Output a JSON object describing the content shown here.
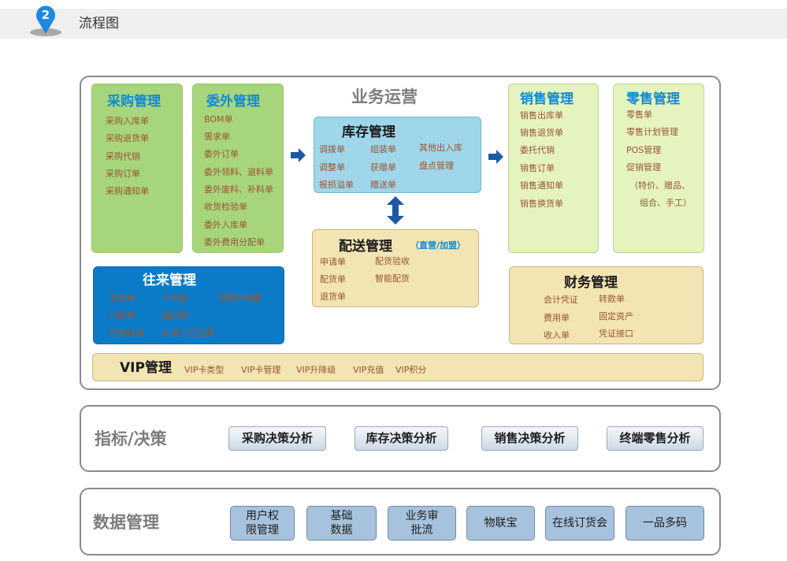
{
  "header": {
    "step_number": "2",
    "title": "流程图"
  },
  "business": {
    "title": "业务运营",
    "purchase": {
      "title": "采购管理",
      "items": [
        "采购入库单",
        "采购退货单",
        "采购代销",
        "采购订单",
        "采购通知单"
      ]
    },
    "outsource": {
      "title": "委外管理",
      "items": [
        "BOM单",
        "需求单",
        "委外订单",
        "委外领料、退料单",
        "委外废料、补料单",
        "收货检验单",
        "委外入库单",
        "委外费用分配单"
      ]
    },
    "inventory": {
      "title": "库存管理",
      "col1": [
        "调拨单",
        "调整单",
        "报损溢单"
      ],
      "col2": [
        "组装单",
        "获赠单",
        "赠送单"
      ],
      "col3": [
        "其他出入库",
        "盘点管理"
      ]
    },
    "delivery": {
      "title": "配送管理",
      "subtitle": "（直营/加盟）",
      "col1": [
        "申请单",
        "配货单",
        "退货单"
      ],
      "col2": [
        "配货验收",
        "智能配货"
      ]
    },
    "sales": {
      "title": "销售管理",
      "items": [
        "销售出库单",
        "销售退货单",
        "委托代销",
        "销售订单",
        "销售通知单",
        "销售换货单"
      ]
    },
    "retail": {
      "title": "零售管理",
      "items": [
        "零售单",
        "零售计划管理",
        "POS管理",
        "促销管理",
        "（特价、赠品、",
        "组合、手工）"
      ]
    },
    "payments": {
      "title": "往来管理",
      "col1": [
        "收款单",
        "付款单",
        "往来核销"
      ],
      "col2": [
        "应收款",
        "应付款",
        "商城专柜结算"
      ],
      "col3": [
        "退换货调整"
      ]
    },
    "finance": {
      "title": "财务管理",
      "col1": [
        "会计凭证",
        "费用单",
        "收入单"
      ],
      "col2": [
        "转款单",
        "固定资产",
        "凭证接口"
      ]
    },
    "vip": {
      "title": "VIP管理",
      "items": [
        "VIP卡类型",
        "VIP卡管理",
        "VIP升降级",
        "VIP充值",
        "VIP积分"
      ]
    }
  },
  "indicators": {
    "title": "指标/决策",
    "buttons": [
      "采购决策分析",
      "库存决策分析",
      "销售决策分析",
      "终端零售分析"
    ]
  },
  "data_mgmt": {
    "title": "数据管理",
    "buttons": [
      "用户权\n限管理",
      "基础\n数据",
      "业务审\n批流",
      "物联宝",
      "在线订货会",
      "一品多码"
    ]
  },
  "colors": {
    "pin": "#1e88e5",
    "header_bg": "#efefef",
    "arrow": "#1d59a5",
    "accent_text": "#118bd3",
    "item_text": "#9a5532"
  }
}
